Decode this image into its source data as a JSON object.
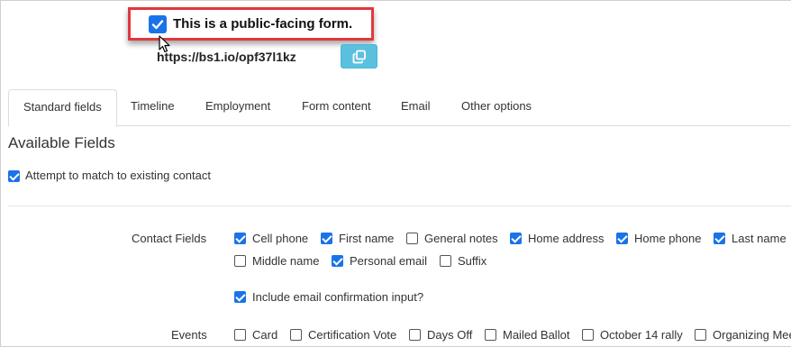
{
  "public_form": {
    "label": "This is a public-facing form.",
    "checked": true,
    "url": "https://bs1.io/opf37l1kz"
  },
  "tabs": [
    {
      "label": "Standard fields",
      "active": true
    },
    {
      "label": "Timeline",
      "active": false
    },
    {
      "label": "Employment",
      "active": false
    },
    {
      "label": "Form content",
      "active": false
    },
    {
      "label": "Email",
      "active": false
    },
    {
      "label": "Other options",
      "active": false
    }
  ],
  "section_title": "Available Fields",
  "match_contact": {
    "label": "Attempt to match to existing contact",
    "checked": true
  },
  "contact_fields": {
    "label": "Contact Fields",
    "options": [
      {
        "label": "Cell phone",
        "checked": true
      },
      {
        "label": "First name",
        "checked": true
      },
      {
        "label": "General notes",
        "checked": false
      },
      {
        "label": "Home address",
        "checked": true
      },
      {
        "label": "Home phone",
        "checked": true
      },
      {
        "label": "Last name",
        "checked": true
      },
      {
        "label": "Middle name",
        "checked": false
      },
      {
        "label": "Personal email",
        "checked": true
      },
      {
        "label": "Suffix",
        "checked": false
      }
    ],
    "email_confirmation": {
      "label": "Include email confirmation input?",
      "checked": true
    }
  },
  "events": {
    "label": "Events",
    "options": [
      {
        "label": "Card",
        "checked": false
      },
      {
        "label": "Certification Vote",
        "checked": false
      },
      {
        "label": "Days Off",
        "checked": false
      },
      {
        "label": "Mailed Ballot",
        "checked": false
      },
      {
        "label": "October 14 rally",
        "checked": false
      },
      {
        "label": "Organizing Mee",
        "checked": false
      }
    ]
  },
  "icons": {
    "checkbox": "checkbox-icon",
    "copy": "copy-icon",
    "cursor": "mouse-cursor-icon"
  }
}
